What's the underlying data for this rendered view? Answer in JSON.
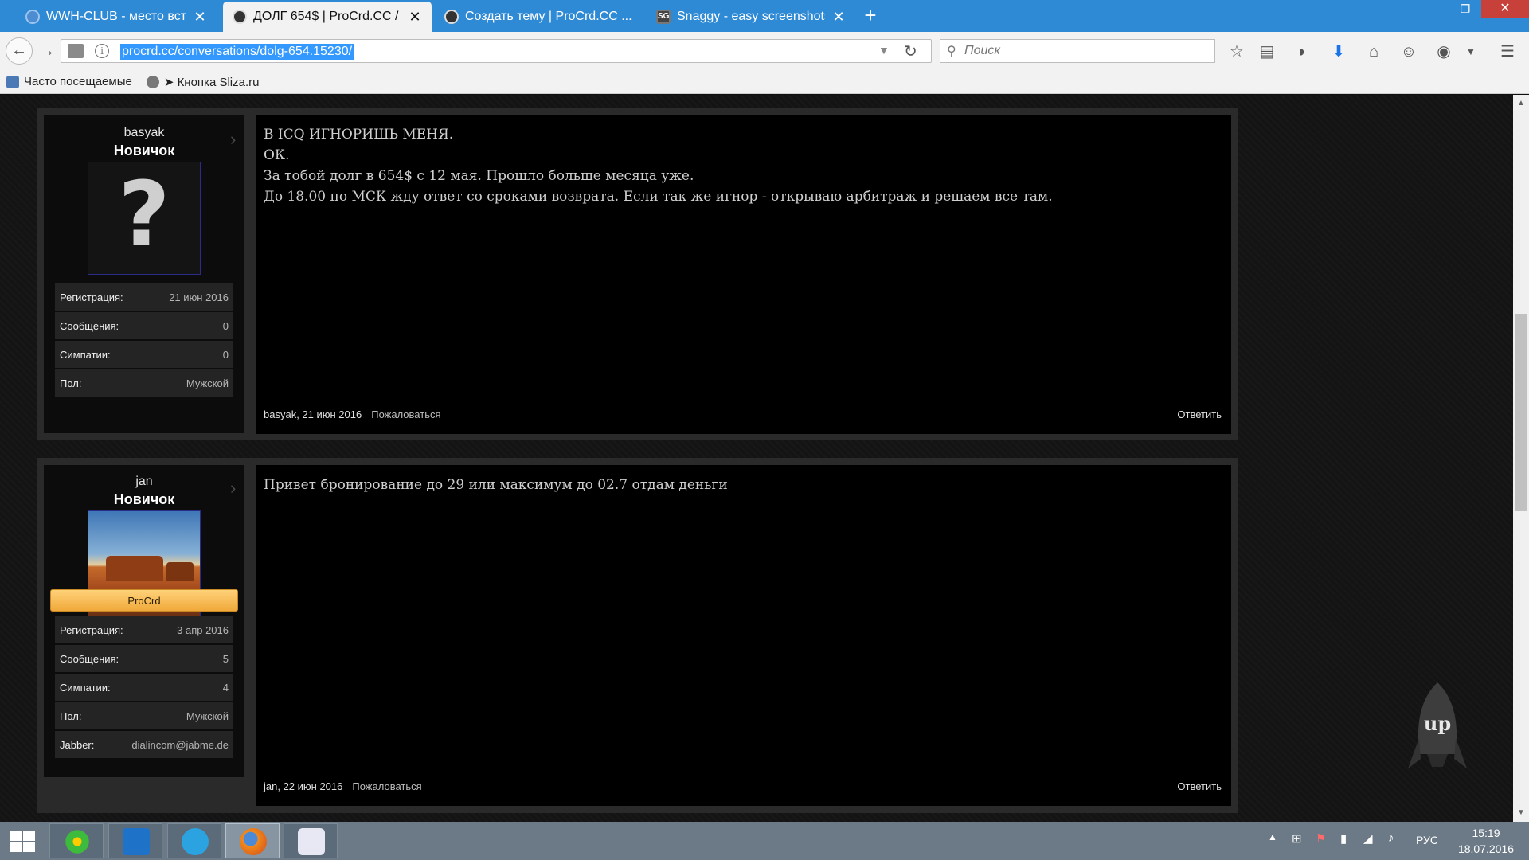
{
  "browser": {
    "tabs": [
      {
        "title": "WWH-CLUB - место встр..."
      },
      {
        "title": "ДОЛГ 654$ | ProCrd.CC / ..."
      },
      {
        "title": "Создать тему | ProCrd.CC ..."
      },
      {
        "title": "Snaggy - easy screenshots"
      }
    ],
    "url": "procrd.cc/conversations/dolg-654.15230/",
    "search_placeholder": "Поиск",
    "bookmarks": [
      {
        "label": "Часто посещаемые"
      },
      {
        "label": "➤ Кнопка Sliza.ru"
      }
    ]
  },
  "posts": [
    {
      "username": "basyak",
      "user_title": "Новичок",
      "avatar": "question-mark",
      "stats": [
        {
          "key": "Регистрация:",
          "value": "21 июн 2016"
        },
        {
          "key": "Сообщения:",
          "value": "0"
        },
        {
          "key": "Симпатии:",
          "value": "0"
        },
        {
          "key": "Пол:",
          "value": "Мужской"
        }
      ],
      "lines": [
        "В ICQ ИГНОРИШЬ МЕНЯ.",
        "ОК.",
        "За тобой долг в 654$ с 12 мая. Прошло больше месяца уже.",
        "До 18.00 по МСК жду ответ со сроками возврата. Если так же игнор - открываю арбитраж и решаем все там."
      ],
      "footer": {
        "author_date": "basyak, 21 июн 2016",
        "report": "Пожаловаться",
        "reply": "Ответить"
      }
    },
    {
      "username": "jan",
      "user_title": "Новичок",
      "avatar": "desert-photo",
      "ribbon": "ProCrd",
      "stats": [
        {
          "key": "Регистрация:",
          "value": "3 апр 2016"
        },
        {
          "key": "Сообщения:",
          "value": "5"
        },
        {
          "key": "Симпатии:",
          "value": "4"
        },
        {
          "key": "Пол:",
          "value": "Мужской"
        },
        {
          "key": "Jabber:",
          "value": "dialincom@jabme.de"
        }
      ],
      "lines": [
        "Привет бронирование до 29 или максимум до 02.7 отдам деньги"
      ],
      "footer": {
        "author_date": "jan, 22 июн 2016",
        "report": "Пожаловаться",
        "reply": "Ответить"
      }
    }
  ],
  "up_button": "up",
  "taskbar": {
    "language": "РУС",
    "time": "15:19",
    "date": "18.07.2016"
  }
}
